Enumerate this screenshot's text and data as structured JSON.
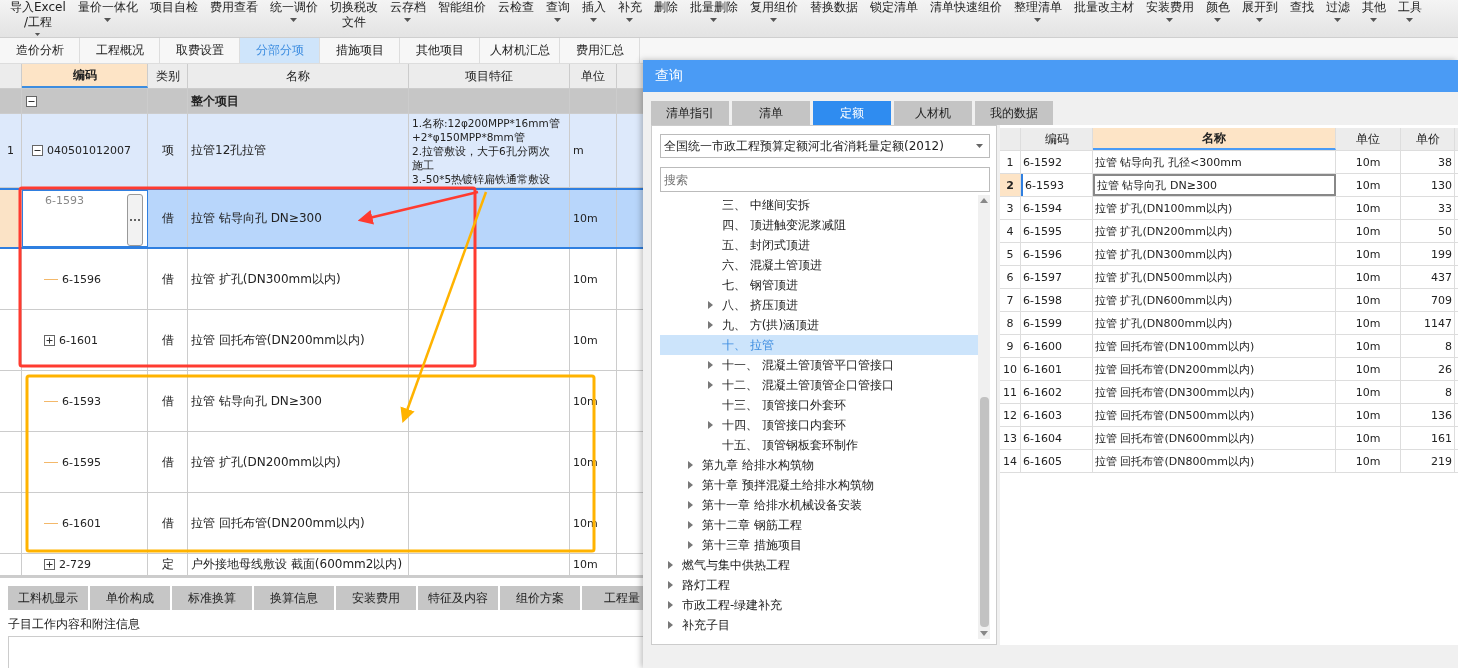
{
  "toolbar": [
    {
      "lines": [
        "导入Excel",
        "/工程"
      ],
      "dropdown": true
    },
    {
      "lines": [
        "量价一体化"
      ],
      "dropdown": true
    },
    {
      "lines": [
        "项目自检"
      ],
      "dropdown": false
    },
    {
      "lines": [
        "费用查看"
      ],
      "dropdown": false
    },
    {
      "lines": [
        "统一调价"
      ],
      "dropdown": true
    },
    {
      "lines": [
        "切换税改",
        "文件"
      ],
      "dropdown": false
    },
    {
      "lines": [
        "云存档"
      ],
      "dropdown": true
    },
    {
      "lines": [
        "智能组价"
      ],
      "dropdown": false
    },
    {
      "lines": [
        "云检查"
      ],
      "dropdown": false
    },
    {
      "lines": [
        "查询"
      ],
      "dropdown": true
    },
    {
      "lines": [
        "插入"
      ],
      "dropdown": true
    },
    {
      "lines": [
        "补充"
      ],
      "dropdown": true
    },
    {
      "lines": [
        "删除"
      ],
      "dropdown": false
    },
    {
      "lines": [
        "批量删除"
      ],
      "dropdown": true
    },
    {
      "lines": [
        "复用组价"
      ],
      "dropdown": true
    },
    {
      "lines": [
        "替换数据"
      ],
      "dropdown": false
    },
    {
      "lines": [
        "锁定清单"
      ],
      "dropdown": false
    },
    {
      "lines": [
        "清单快速组价"
      ],
      "dropdown": false
    },
    {
      "lines": [
        "整理清单"
      ],
      "dropdown": true
    },
    {
      "lines": [
        "批量改主材"
      ],
      "dropdown": false
    },
    {
      "lines": [
        "安装费用"
      ],
      "dropdown": true
    },
    {
      "lines": [
        "颜色"
      ],
      "dropdown": true
    },
    {
      "lines": [
        "展开到"
      ],
      "dropdown": true
    },
    {
      "lines": [
        "查找"
      ],
      "dropdown": false
    },
    {
      "lines": [
        "过滤"
      ],
      "dropdown": true
    },
    {
      "lines": [
        "其他"
      ],
      "dropdown": true
    },
    {
      "lines": [
        "工具"
      ],
      "dropdown": true
    }
  ],
  "tabs": [
    {
      "label": "造价分析",
      "selected": false
    },
    {
      "label": "工程概况",
      "selected": false
    },
    {
      "label": "取费设置",
      "selected": false
    },
    {
      "label": "分部分项",
      "selected": true
    },
    {
      "label": "措施项目",
      "selected": false
    },
    {
      "label": "其他项目",
      "selected": false
    },
    {
      "label": "人材机汇总",
      "selected": false
    },
    {
      "label": "费用汇总",
      "selected": false
    }
  ],
  "table": {
    "columns": [
      "编码",
      "类别",
      "名称",
      "项目特征",
      "单位"
    ],
    "rows": [
      {
        "kind": "group",
        "num": "",
        "code": "",
        "type": "",
        "name": "整个项目",
        "feature": [],
        "unit": "",
        "expanded": true,
        "selected": false
      },
      {
        "kind": "item",
        "num": "1",
        "code": "040501012007",
        "type": "项",
        "name": "拉管12孔拉管",
        "feature": [
          "1.名称:12φ200MPP*16mm管",
          "+2*φ150MPP*8mm管",
          "2.拉管敷设，大于6孔分两次",
          "施工",
          "3.-50*5热镀锌扁铁通常敷设"
        ],
        "unit": "m",
        "expanded": true,
        "selected": false
      },
      {
        "kind": "sub",
        "num": "",
        "code": "6-1593",
        "type": "借",
        "name": "拉管 钻导向孔 DN≥300",
        "feature": [],
        "unit": "10m",
        "selected": true
      },
      {
        "kind": "sub",
        "num": "",
        "code": "6-1596",
        "type": "借",
        "name": "拉管 扩孔(DN300mm以内)",
        "feature": [],
        "unit": "10m",
        "selected": false
      },
      {
        "kind": "sub",
        "num": "",
        "code": "6-1601",
        "type": "借",
        "name": "拉管 回托布管(DN200mm以内)",
        "feature": [],
        "unit": "10m",
        "expanded": false,
        "selected": false
      },
      {
        "kind": "sub",
        "num": "",
        "code": "6-1593",
        "type": "借",
        "name": "拉管 钻导向孔 DN≥300",
        "feature": [],
        "unit": "10m",
        "selected": false
      },
      {
        "kind": "sub",
        "num": "",
        "code": "6-1595",
        "type": "借",
        "name": "拉管 扩孔(DN200mm以内)",
        "feature": [],
        "unit": "10m",
        "selected": false
      },
      {
        "kind": "sub",
        "num": "",
        "code": "6-1601",
        "type": "借",
        "name": "拉管 回托布管(DN200mm以内)",
        "feature": [],
        "unit": "10m",
        "selected": false
      },
      {
        "kind": "sub",
        "num": "",
        "code": "2-729",
        "type": "定",
        "name": "户外接地母线敷设 截面(600mm2以内)",
        "feature": [],
        "unit": "10m",
        "expanded": false,
        "selected": false
      }
    ]
  },
  "annotations": [
    {
      "kind": "frame",
      "color": "#ff3b30"
    },
    {
      "kind": "arrow",
      "color": "#ff3b30"
    },
    {
      "kind": "frame",
      "color": "#ffb300"
    },
    {
      "kind": "arrow",
      "color": "#ffb300"
    }
  ],
  "bottom_tabs": [
    "工料机显示",
    "单价构成",
    "标准换算",
    "换算信息",
    "安装费用",
    "特征及内容",
    "组价方案",
    "工程量"
  ],
  "notes_label": "子目工作内容和附注信息",
  "dialog": {
    "title": "查询",
    "tabs": [
      {
        "label": "清单指引",
        "selected": false
      },
      {
        "label": "清单",
        "selected": false
      },
      {
        "label": "定额",
        "selected": true
      },
      {
        "label": "人材机",
        "selected": false
      },
      {
        "label": "我的数据",
        "selected": false
      }
    ],
    "library": "全国统一市政工程预算定额河北省消耗量定额(2012)",
    "search": {
      "placeholder": "搜索"
    },
    "tree": {
      "children": [
        {
          "children": [
            {
              "children": [
                {
                  "label": "三、 中继间安拆",
                  "expandable": false,
                  "selected": false
                },
                {
                  "label": "四、 顶进触变泥浆减阻",
                  "expandable": false,
                  "selected": false
                },
                {
                  "label": "五、 封闭式顶进",
                  "expandable": false,
                  "selected": false
                },
                {
                  "label": "六、 混凝土管顶进",
                  "expandable": false,
                  "selected": false
                },
                {
                  "label": "七、 钢管顶进",
                  "expandable": false,
                  "selected": false
                },
                {
                  "label": "八、 挤压顶进",
                  "expandable": true,
                  "selected": false
                },
                {
                  "label": "九、 方(拱)涵顶进",
                  "expandable": true,
                  "selected": false
                },
                {
                  "label": "十、 拉管",
                  "expandable": false,
                  "selected": true
                },
                {
                  "label": "十一、 混凝土管顶管平口管接口",
                  "expandable": true,
                  "selected": false
                },
                {
                  "label": "十二、 混凝土管顶管企口管接口",
                  "expandable": true,
                  "selected": false
                },
                {
                  "label": "十三、 顶管接口外套环",
                  "expandable": false,
                  "selected": false
                },
                {
                  "label": "十四、 顶管接口内套环",
                  "expandable": true,
                  "selected": false
                },
                {
                  "label": "十五、 顶管钢板套环制作",
                  "expandable": false,
                  "selected": false
                }
              ]
            },
            {
              "label": "第九章 给排水构筑物",
              "expandable": true,
              "selected": false
            },
            {
              "label": "第十章 预拌混凝土给排水构筑物",
              "expandable": true,
              "selected": false
            },
            {
              "label": "第十一章 给排水机械设备安装",
              "expandable": true,
              "selected": false
            },
            {
              "label": "第十二章 钢筋工程",
              "expandable": true,
              "selected": false
            },
            {
              "label": "第十三章 措施项目",
              "expandable": true,
              "selected": false
            }
          ]
        },
        {
          "label": "燃气与集中供热工程",
          "expandable": true,
          "selected": false
        },
        {
          "label": "路灯工程",
          "expandable": true,
          "selected": false
        },
        {
          "label": "市政工程-绿建补充",
          "expandable": true,
          "selected": false
        },
        {
          "label": "补充子目",
          "expandable": true,
          "selected": false
        }
      ]
    },
    "results": {
      "columns": [
        "编码",
        "名称",
        "单位",
        "单价"
      ],
      "rows": [
        {
          "num": "1",
          "code": "6-1592",
          "name": "拉管 钻导向孔 孔径<300mm",
          "unit": "10m",
          "price": "38",
          "selected": false
        },
        {
          "num": "2",
          "code": "6-1593",
          "name": "拉管 钻导向孔 DN≥300",
          "unit": "10m",
          "price": "130",
          "selected": true
        },
        {
          "num": "3",
          "code": "6-1594",
          "name": "拉管 扩孔(DN100mm以内)",
          "unit": "10m",
          "price": "33",
          "selected": false
        },
        {
          "num": "4",
          "code": "6-1595",
          "name": "拉管 扩孔(DN200mm以内)",
          "unit": "10m",
          "price": "50",
          "selected": false
        },
        {
          "num": "5",
          "code": "6-1596",
          "name": "拉管 扩孔(DN300mm以内)",
          "unit": "10m",
          "price": "199",
          "selected": false
        },
        {
          "num": "6",
          "code": "6-1597",
          "name": "拉管 扩孔(DN500mm以内)",
          "unit": "10m",
          "price": "437",
          "selected": false
        },
        {
          "num": "7",
          "code": "6-1598",
          "name": "拉管 扩孔(DN600mm以内)",
          "unit": "10m",
          "price": "709",
          "selected": false
        },
        {
          "num": "8",
          "code": "6-1599",
          "name": "拉管 扩孔(DN800mm以内)",
          "unit": "10m",
          "price": "1147",
          "selected": false
        },
        {
          "num": "9",
          "code": "6-1600",
          "name": "拉管 回托布管(DN100mm以内)",
          "unit": "10m",
          "price": "8",
          "selected": false
        },
        {
          "num": "10",
          "code": "6-1601",
          "name": "拉管 回托布管(DN200mm以内)",
          "unit": "10m",
          "price": "26",
          "selected": false
        },
        {
          "num": "11",
          "code": "6-1602",
          "name": "拉管 回托布管(DN300mm以内)",
          "unit": "10m",
          "price": "8",
          "selected": false
        },
        {
          "num": "12",
          "code": "6-1603",
          "name": "拉管 回托布管(DN500mm以内)",
          "unit": "10m",
          "price": "136",
          "selected": false
        },
        {
          "num": "13",
          "code": "6-1604",
          "name": "拉管 回托布管(DN600mm以内)",
          "unit": "10m",
          "price": "161",
          "selected": false
        },
        {
          "num": "14",
          "code": "6-1605",
          "name": "拉管 回托布管(DN800mm以内)",
          "unit": "10m",
          "price": "219",
          "selected": false
        }
      ]
    }
  }
}
